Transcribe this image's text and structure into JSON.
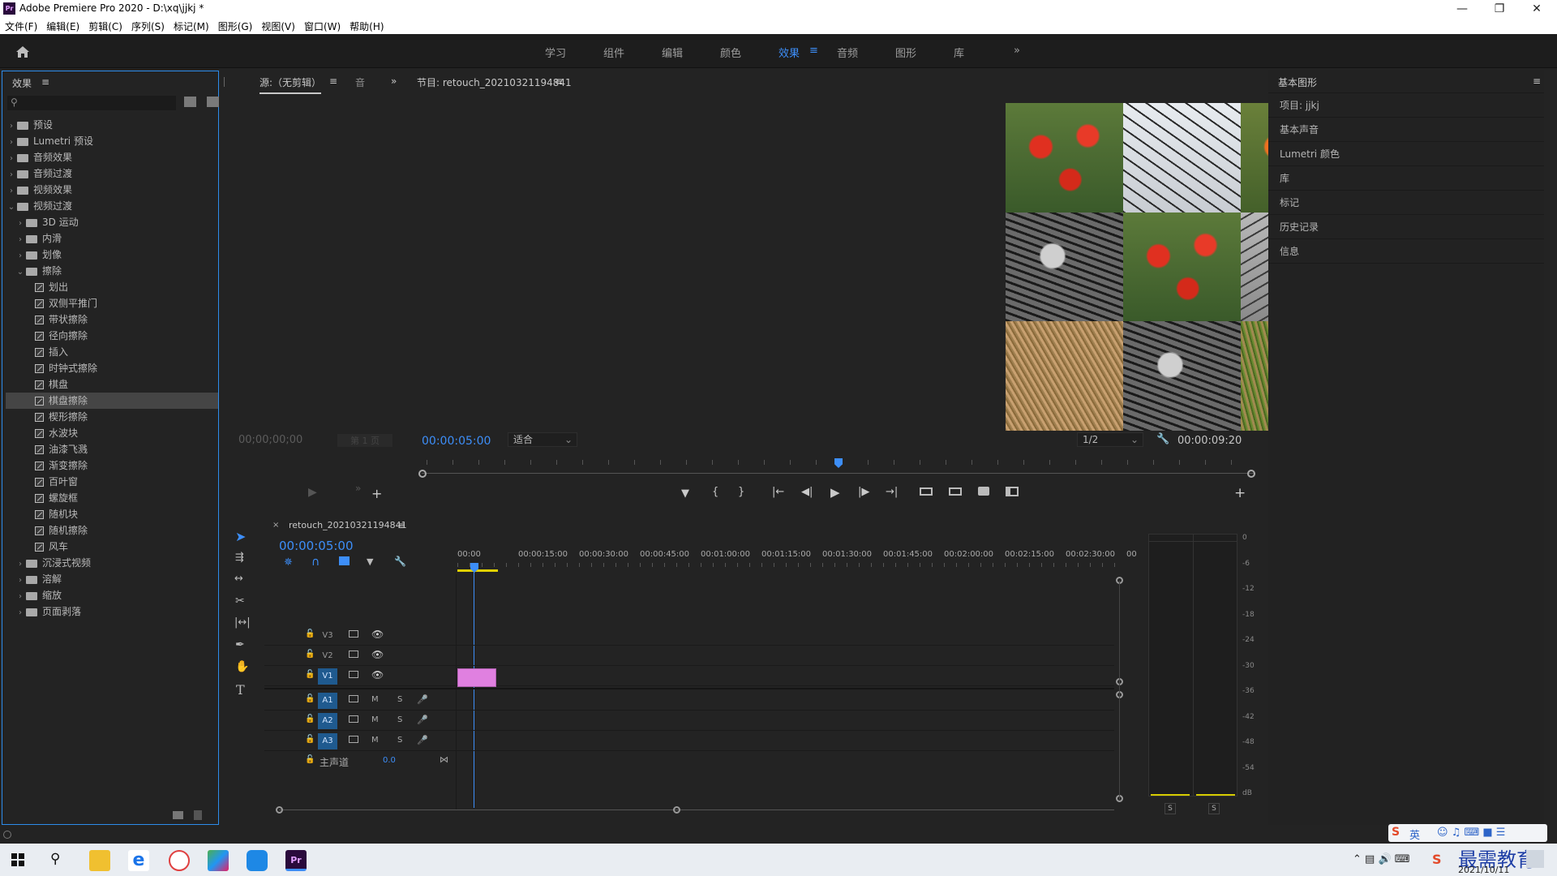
{
  "window": {
    "title": "Adobe Premiere Pro 2020 - D:\\xq\\jjkj *",
    "logo": "Pr"
  },
  "menu": [
    "文件(F)",
    "编辑(E)",
    "剪辑(C)",
    "序列(S)",
    "标记(M)",
    "图形(G)",
    "视图(V)",
    "窗口(W)",
    "帮助(H)"
  ],
  "workspaces": [
    "学习",
    "组件",
    "编辑",
    "颜色",
    "效果",
    "音频",
    "图形",
    "库"
  ],
  "active_workspace": "效果",
  "effects_panel": {
    "title": "效果",
    "tree": [
      {
        "label": "预设",
        "level": 0,
        "kind": "folder",
        "open": false
      },
      {
        "label": "Lumetri 预设",
        "level": 0,
        "kind": "folder",
        "open": false
      },
      {
        "label": "音频效果",
        "level": 0,
        "kind": "folder",
        "open": false
      },
      {
        "label": "音频过渡",
        "level": 0,
        "kind": "folder",
        "open": false
      },
      {
        "label": "视频效果",
        "level": 0,
        "kind": "folder",
        "open": false
      },
      {
        "label": "视频过渡",
        "level": 0,
        "kind": "folder",
        "open": true
      },
      {
        "label": "3D 运动",
        "level": 1,
        "kind": "folder",
        "open": false
      },
      {
        "label": "内滑",
        "level": 1,
        "kind": "folder",
        "open": false
      },
      {
        "label": "划像",
        "level": 1,
        "kind": "folder",
        "open": false
      },
      {
        "label": "擦除",
        "level": 1,
        "kind": "folder",
        "open": true
      },
      {
        "label": "划出",
        "level": 2,
        "kind": "fx"
      },
      {
        "label": "双侧平推门",
        "level": 2,
        "kind": "fx"
      },
      {
        "label": "带状擦除",
        "level": 2,
        "kind": "fx"
      },
      {
        "label": "径向擦除",
        "level": 2,
        "kind": "fx"
      },
      {
        "label": "插入",
        "level": 2,
        "kind": "fx"
      },
      {
        "label": "时钟式擦除",
        "level": 2,
        "kind": "fx"
      },
      {
        "label": "棋盘",
        "level": 2,
        "kind": "fx"
      },
      {
        "label": "棋盘擦除",
        "level": 2,
        "kind": "fx",
        "selected": true
      },
      {
        "label": "楔形擦除",
        "level": 2,
        "kind": "fx"
      },
      {
        "label": "水波块",
        "level": 2,
        "kind": "fx"
      },
      {
        "label": "油漆飞溅",
        "level": 2,
        "kind": "fx"
      },
      {
        "label": "渐变擦除",
        "level": 2,
        "kind": "fx"
      },
      {
        "label": "百叶窗",
        "level": 2,
        "kind": "fx"
      },
      {
        "label": "螺旋框",
        "level": 2,
        "kind": "fx"
      },
      {
        "label": "随机块",
        "level": 2,
        "kind": "fx"
      },
      {
        "label": "随机擦除",
        "level": 2,
        "kind": "fx"
      },
      {
        "label": "风车",
        "level": 2,
        "kind": "fx"
      },
      {
        "label": "沉浸式视频",
        "level": 1,
        "kind": "folder",
        "open": false
      },
      {
        "label": "溶解",
        "level": 1,
        "kind": "folder",
        "open": false
      },
      {
        "label": "缩放",
        "level": 1,
        "kind": "folder",
        "open": false
      },
      {
        "label": "页面剥落",
        "level": 1,
        "kind": "folder",
        "open": false
      }
    ]
  },
  "source_panel": {
    "tab1": "源:（无剪辑）",
    "tab2": "音",
    "timecode": "00;00;00;00",
    "page": "第 1 页"
  },
  "program_panel": {
    "title": "节目: retouch_20210321194841",
    "timecode_left": "00:00:05:00",
    "fit": "适合",
    "resolution": "1/2",
    "timecode_right": "00:00:09:20",
    "playhead_fraction": 0.5,
    "tiles": [
      {
        "tone": "tulip-red"
      },
      {
        "tone": "cherry-sky"
      },
      {
        "tone": "tulip-orange"
      },
      {
        "tone": "cherry-gray"
      },
      {
        "tone": "cherry-dark"
      },
      {
        "tone": "tulip-red"
      },
      {
        "tone": "cherry-gray"
      },
      {
        "tone": "tulip-yellow"
      },
      {
        "tone": "straw"
      },
      {
        "tone": "cherry-dark"
      },
      {
        "tone": "grass"
      },
      {
        "tone": "cherry-dark"
      }
    ]
  },
  "essential_graphics": {
    "title": "基本图形",
    "items": [
      "项目: jjkj",
      "基本声音",
      "Lumetri 颜色",
      "库",
      "标记",
      "历史记录",
      "信息"
    ]
  },
  "timeline": {
    "tab": "retouch_20210321194841",
    "timecode": "00:00:05:00",
    "ruler": [
      "00:00",
      "00:00:15:00",
      "00:00:30:00",
      "00:00:45:00",
      "00:01:00:00",
      "00:01:15:00",
      "00:01:30:00",
      "00:01:45:00",
      "00:02:00:00",
      "00:02:15:00",
      "00:02:30:00",
      "00:"
    ],
    "video_tracks": [
      "V3",
      "V2",
      "V1"
    ],
    "audio_tracks": [
      "A1",
      "A2",
      "A3"
    ],
    "master": {
      "label": "主声道",
      "value": "0.0"
    },
    "clip_color": "#e080e0"
  },
  "meter": {
    "ticks": [
      "0",
      "-6",
      "-12",
      "-18",
      "-24",
      "-30",
      "-36",
      "-42",
      "-48",
      "-54",
      "dB"
    ],
    "solo": [
      "S",
      "S"
    ]
  },
  "taskbar": {
    "clock_text": "最需教育",
    "date": "2021/10/11",
    "ime": "英"
  },
  "colors": {
    "accent": "#3d8ef8",
    "panel_bg": "#232323",
    "selection": "#454545"
  }
}
